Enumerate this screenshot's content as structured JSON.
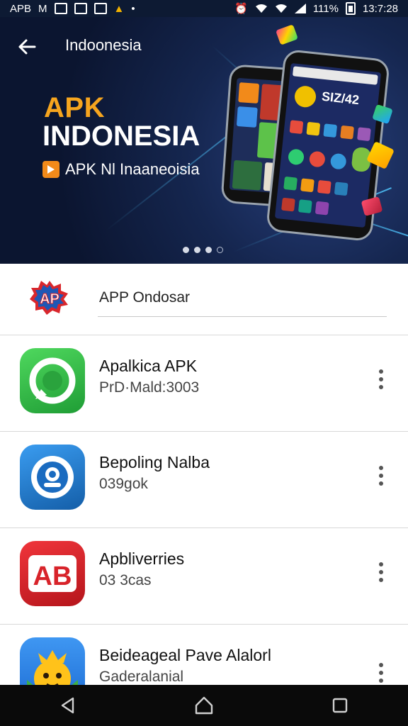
{
  "status_bar": {
    "left_text_1": "APB",
    "left_text_2": "M",
    "battery_percent": "111%",
    "time": "13:7:28"
  },
  "header": {
    "back_icon": "arrow-back-icon",
    "title": "Indoonesia"
  },
  "banner": {
    "line1": "APK",
    "line2": "INDONESIA",
    "badge_text": "APK Nl Inaaneoisia",
    "phone_screen_label": "SIZ/42",
    "pages": 4,
    "active_page": 3,
    "colors": {
      "line1": "#f6a51e",
      "background": "#0b1530",
      "badge": "#f28a1a"
    }
  },
  "search": {
    "logo_text": "AP",
    "label": "APP Ondosar"
  },
  "apps": [
    {
      "name": "Apalkica APK",
      "subtitle": "PrD·Mald:3003",
      "icon": "whatsapp-style-icon",
      "color": "#35b64a"
    },
    {
      "name": "Bepoling Nalba",
      "subtitle": "039gok",
      "icon": "camera-lens-icon",
      "color": "#1e7bc9"
    },
    {
      "name": "Apbliverries",
      "subtitle": "03 3cas",
      "icon": "ab-logo-icon",
      "color": "#e0252b",
      "icon_text": "AB"
    },
    {
      "name": "Beideageal Pave Alalorl",
      "subtitle": "Gaderalanial",
      "icon": "cartoon-sun-icon",
      "color": "#2b86e8"
    }
  ],
  "nav": {
    "back": "triangle-back-icon",
    "home": "home-icon",
    "recents": "square-recents-icon"
  }
}
